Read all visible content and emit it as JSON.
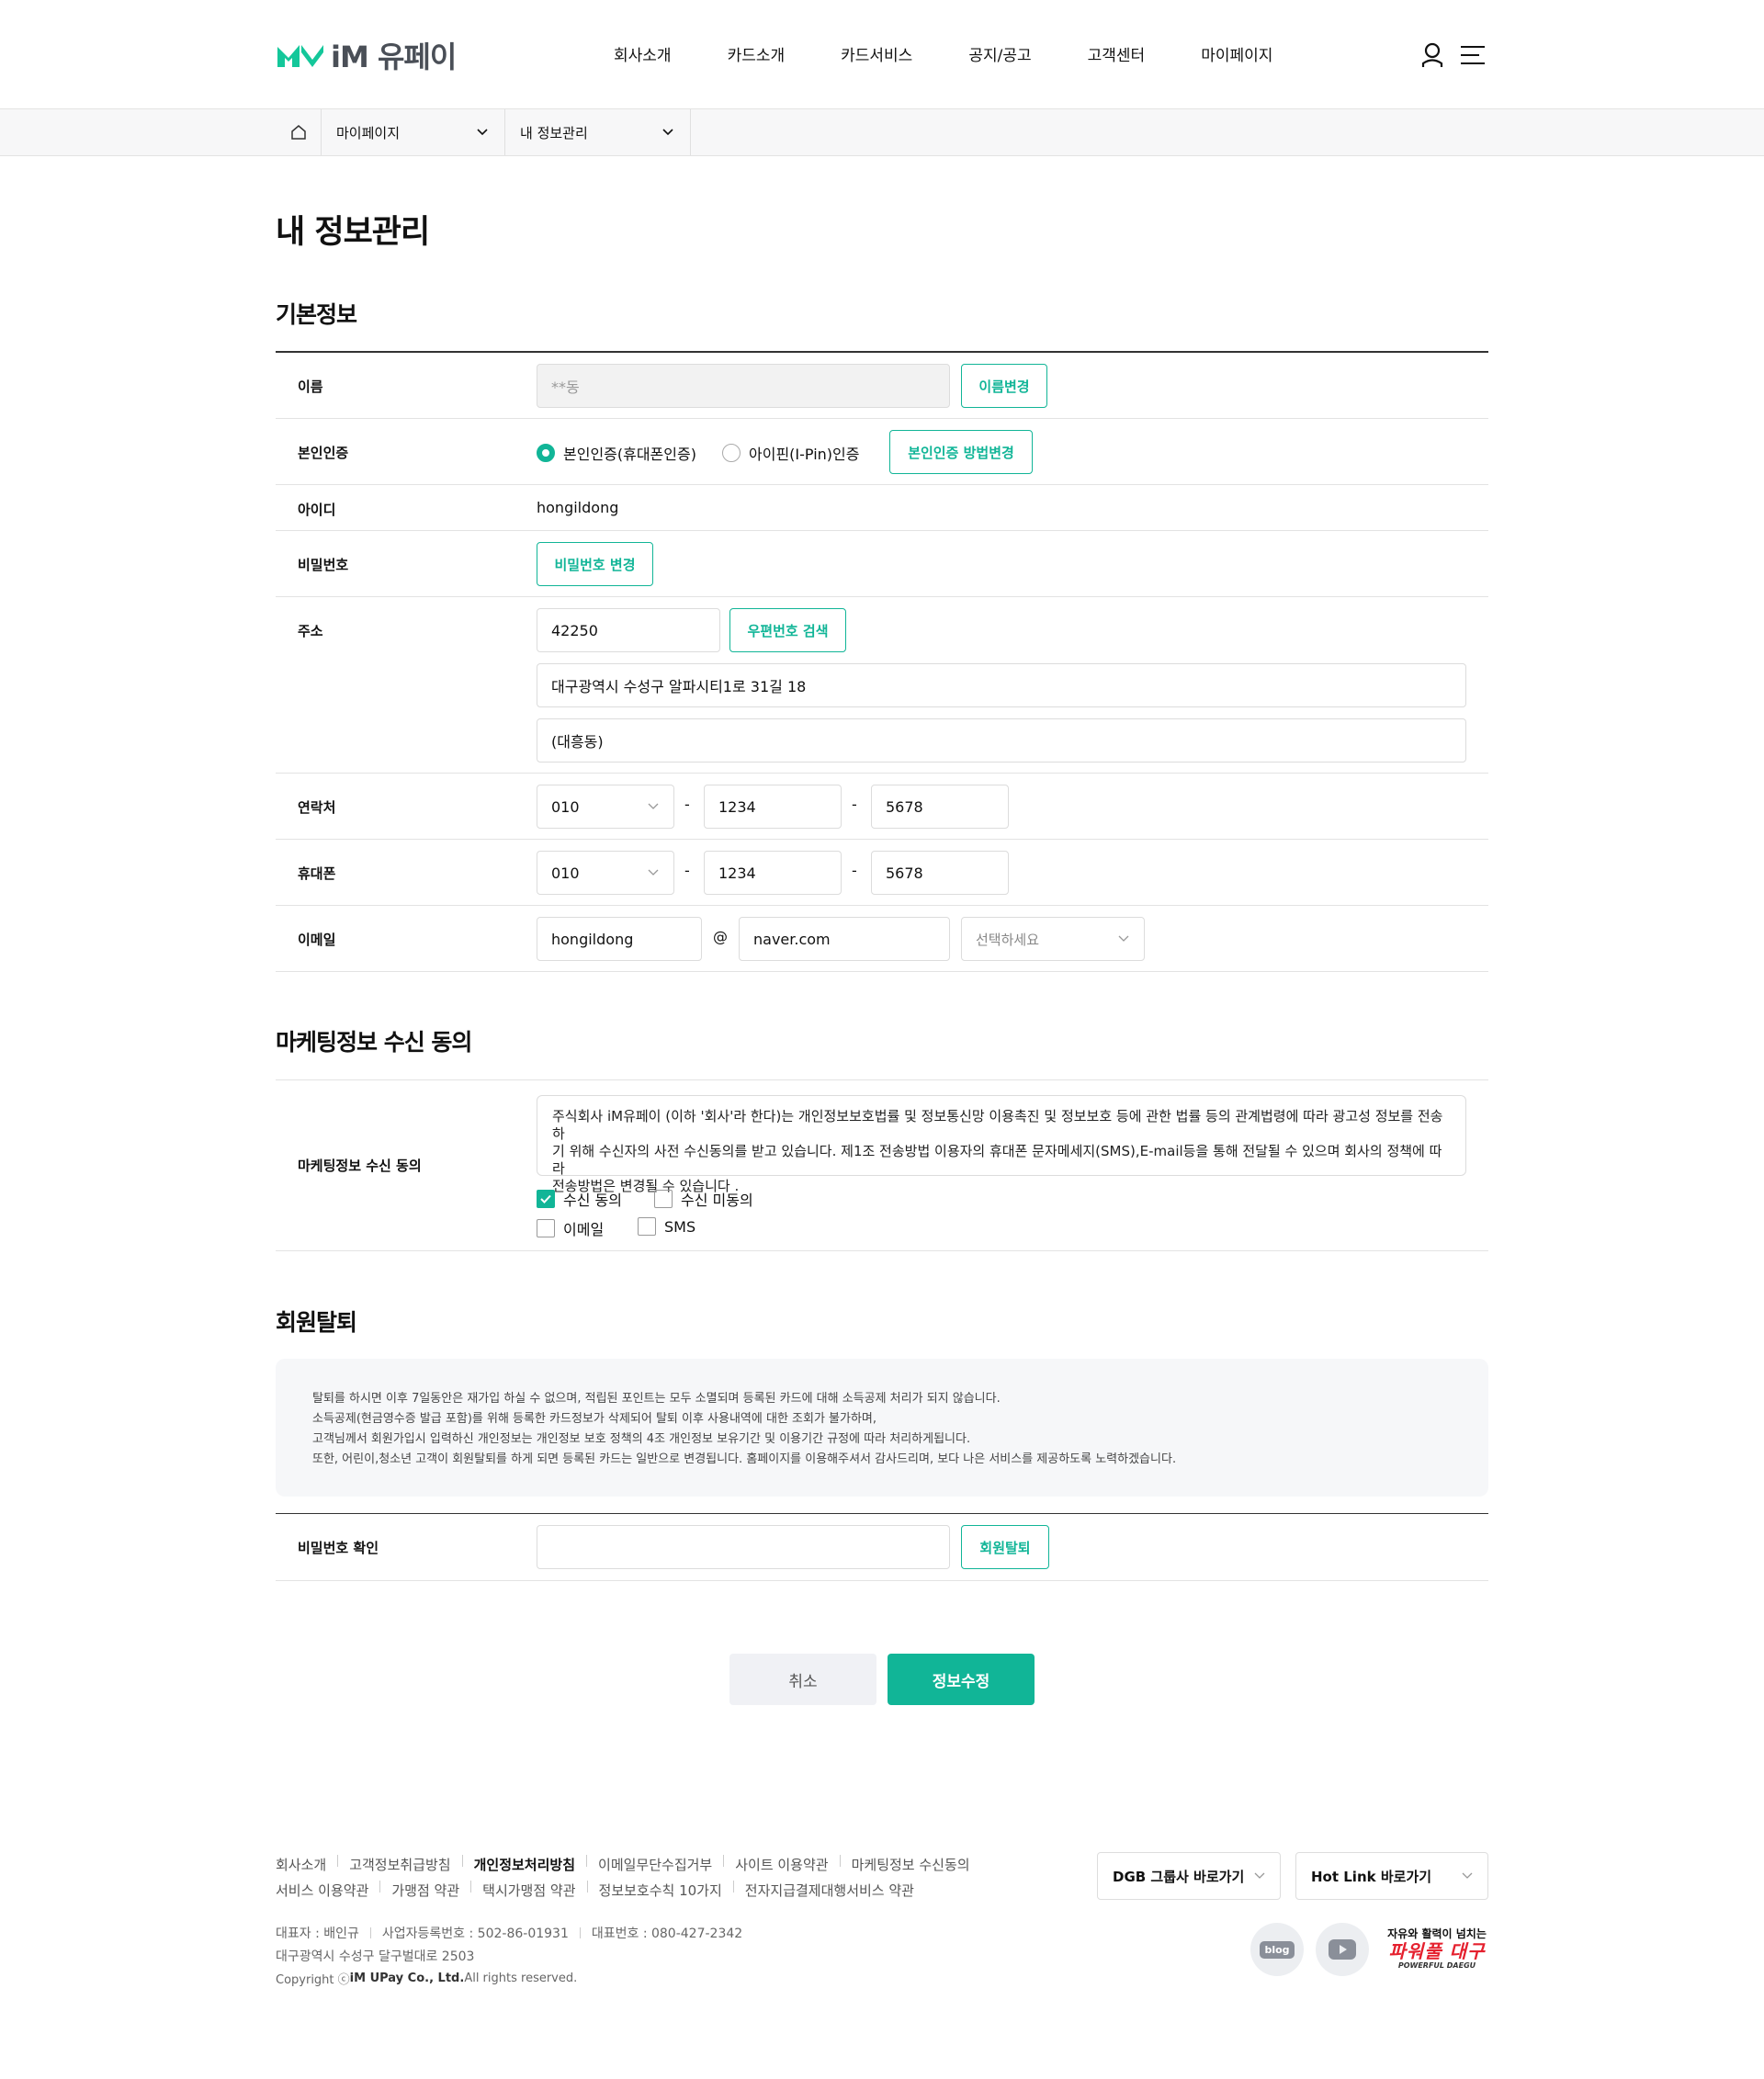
{
  "brand": {
    "name": "iM 유페이",
    "accent": "#11b597"
  },
  "gnb": [
    "회사소개",
    "카드소개",
    "카드서비스",
    "공지/공고",
    "고객센터",
    "마이페이지"
  ],
  "header_icons": [
    "user-icon",
    "menu-icon"
  ],
  "breadcrumb": {
    "level1": "마이페이지",
    "level2": "내 정보관리"
  },
  "page_title": "내 정보관리",
  "basic": {
    "title": "기본정보",
    "name_label": "이름",
    "name_value": "**동",
    "name_button": "이름변경",
    "auth_label": "본인인증",
    "auth_option1": "본인인증(휴대폰인증)",
    "auth_option2": "아이핀(I-Pin)인증",
    "auth_button": "본인인증 방법변경",
    "id_label": "아이디",
    "id_value": "hongildong",
    "pw_label": "비밀번호",
    "pw_button": "비밀번호 변경",
    "addr_label": "주소",
    "zip": "42250",
    "zip_button": "우편번호 검색",
    "addr1": "대구광역시 수성구 알파시티1로 31길 18",
    "addr2": "(대흥동)",
    "tel_label": "연락처",
    "tel": [
      "010",
      "1234",
      "5678"
    ],
    "mobile_label": "휴대폰",
    "mobile": [
      "010",
      "1234",
      "5678"
    ],
    "email_label": "이메일",
    "email_id": "hongildong",
    "email_at": "@",
    "email_domain": "naver.com",
    "email_select": "선택하세요",
    "dash": "-"
  },
  "marketing": {
    "title": "마케팅정보 수신 동의",
    "label": "마케팅정보 수신 동의",
    "text_line1": "주식회사  iM유페이 (이하 '회사'라 한다)는 개인정보보호법률 및 정보통신망 이용촉진 및 정보보호 등에 관한 법률 등의 관계법령에 따라 광고성 정보를 전송하",
    "text_line2": "기 위해 수신자의 사전 수신동의를 받고 있습니다. 제1조 전송방법 이용자의 휴대폰 문자메세지(SMS),E-mail등을 통해 전달될 수 있으며 회사의 정책에 따라",
    "text_line3": "전송방법은 변경될 수 있습니다 .",
    "agree": "수신 동의",
    "disagree": "수신 미동의",
    "email": "이메일",
    "sms": "SMS"
  },
  "withdraw": {
    "title": "회원탈퇴",
    "info": [
      "탈퇴를 하시면 이후 7일동안은 재가입 하실 수 없으며, 적립된 포인트는 모두 소멸되며 등록된 카드에 대해 소득공제 처리가 되지 않습니다.",
      "소득공제(현금영수증 발급 포함)를 위해 등록한 카드정보가 삭제되어 탈퇴 이후 사용내역에 대한 조회가 불가하며,",
      "고객님께서 회원가입시 입력하신 개인정보는 개인정보 보호 정책의 4조 개인정보 보유기간 및 이용기간 규정에 따라 처리하게됩니다.",
      "또한, 어린이,청소년 고객이 회원탈퇴를 하게 되면 등록된 카드는 일반으로 변경됩니다.  홈페이지를 이용해주셔서 감사드리며, 보다 나은 서비스를 제공하도록 노력하겠습니다."
    ],
    "pw_label": "비밀번호 확인",
    "button": "회원탈퇴"
  },
  "actions": {
    "cancel": "취소",
    "submit": "정보수정"
  },
  "footer": {
    "links_row1": [
      "회사소개",
      "고객정보취급방침",
      "개인정보처리방침",
      "이메일무단수집거부",
      "사이트 이용약관",
      "마케팅정보 수신동의"
    ],
    "links_row2": [
      "서비스 이용약관",
      "가맹점 약관",
      "택시가맹점 약관",
      "정보보호수칙 10가지",
      "전자지급결제대행서비스 약관"
    ],
    "ceo": "대표자 : 배인규",
    "bizno": "사업자등록번호 : 502-86-01931",
    "phone": "대표번호 : 080-427-2342",
    "address": "대구광역시 수성구 달구벌대로 2503",
    "copy_prefix": "Copyright ⓒ",
    "copy_company": "iM UPay Co., Ltd.",
    "copy_suffix": " All rights reserved.",
    "dgb_select": "DGB 그룹사 바로가기",
    "hotlink_select": "Hot Link 바로가기",
    "blog": "blog",
    "daegu_line1": "자유와 활력이 넘치는",
    "daegu_line2": "파워풀 대구",
    "daegu_line3": "POWERFUL DAEGU"
  }
}
